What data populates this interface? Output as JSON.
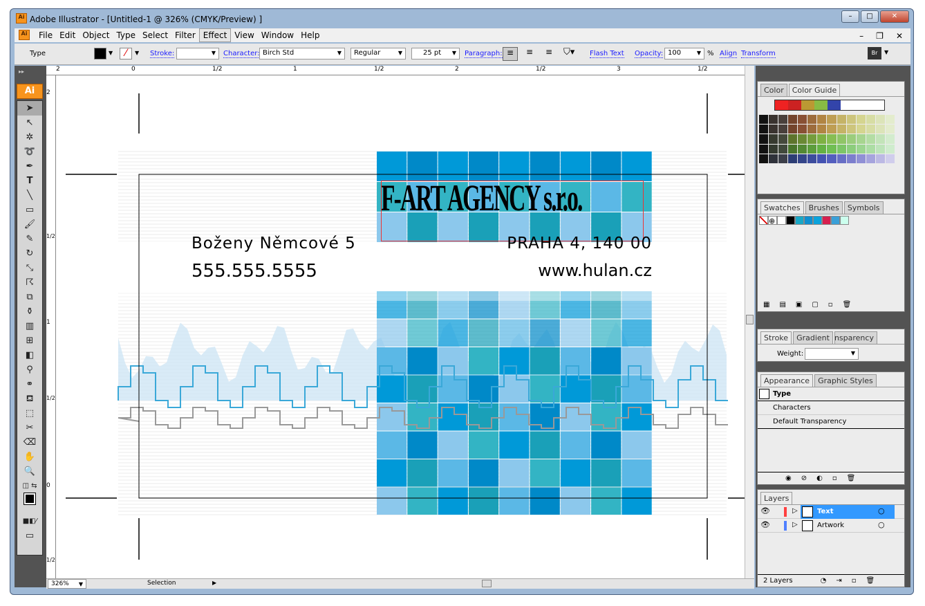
{
  "app": {
    "title": "Adobe Illustrator - [Untitled-1 @ 326% (CMYK/Preview) ]",
    "logo": "Ai"
  },
  "menu": [
    "File",
    "Edit",
    "Object",
    "Type",
    "Select",
    "Filter",
    "Effect",
    "View",
    "Window",
    "Help"
  ],
  "control": {
    "selection_type": "Type",
    "stroke_label": "Stroke:",
    "character_label": "Character:",
    "font": "Birch Std",
    "style": "Regular",
    "size": "25 pt",
    "paragraph_label": "Paragraph:",
    "flash_text": "Flash Text",
    "opacity_label": "Opacity:",
    "opacity": "100",
    "opacity_unit": "%",
    "align": "Align",
    "transform": "Transform"
  },
  "ruler": {
    "top": [
      "2",
      "0",
      "1/2",
      "1",
      "1/2",
      "2",
      "1/2",
      "3",
      "1/2"
    ],
    "left": [
      "2",
      "1/2",
      "1",
      "1/2",
      "0",
      "1/2"
    ]
  },
  "artwork": {
    "headline": "F-ART AGENCY s.r.o.",
    "address1": "Boženy Němcové 5",
    "address2": "PRAHA 4, 140 00",
    "phone": "555.555.5555",
    "web": "www.hulan.cz",
    "colors": {
      "blue": "#0099d8",
      "teal": "#33b4c4",
      "light": "#8cc8ec"
    }
  },
  "status": {
    "zoom": "326%",
    "tool": "Selection"
  },
  "panels": {
    "color": {
      "tabs": [
        "Color",
        "Color Guide"
      ]
    },
    "swatches": {
      "tabs": [
        "Swatches",
        "Brushes",
        "Symbols"
      ]
    },
    "stroke": {
      "tabs": [
        "Stroke",
        "Gradient",
        "Transparency"
      ],
      "weight_label": "Weight:"
    },
    "appearance": {
      "tabs": [
        "Appearance",
        "Graphic Styles"
      ],
      "rows": [
        "Type",
        "Characters",
        "Default Transparency"
      ]
    },
    "layers": {
      "tabs": [
        "Layers"
      ],
      "items": [
        {
          "name": "Text",
          "color": "#ff4040",
          "selected": true
        },
        {
          "name": "Artwork",
          "color": "#4f7fff",
          "selected": false
        }
      ],
      "count": "2 Layers"
    }
  }
}
